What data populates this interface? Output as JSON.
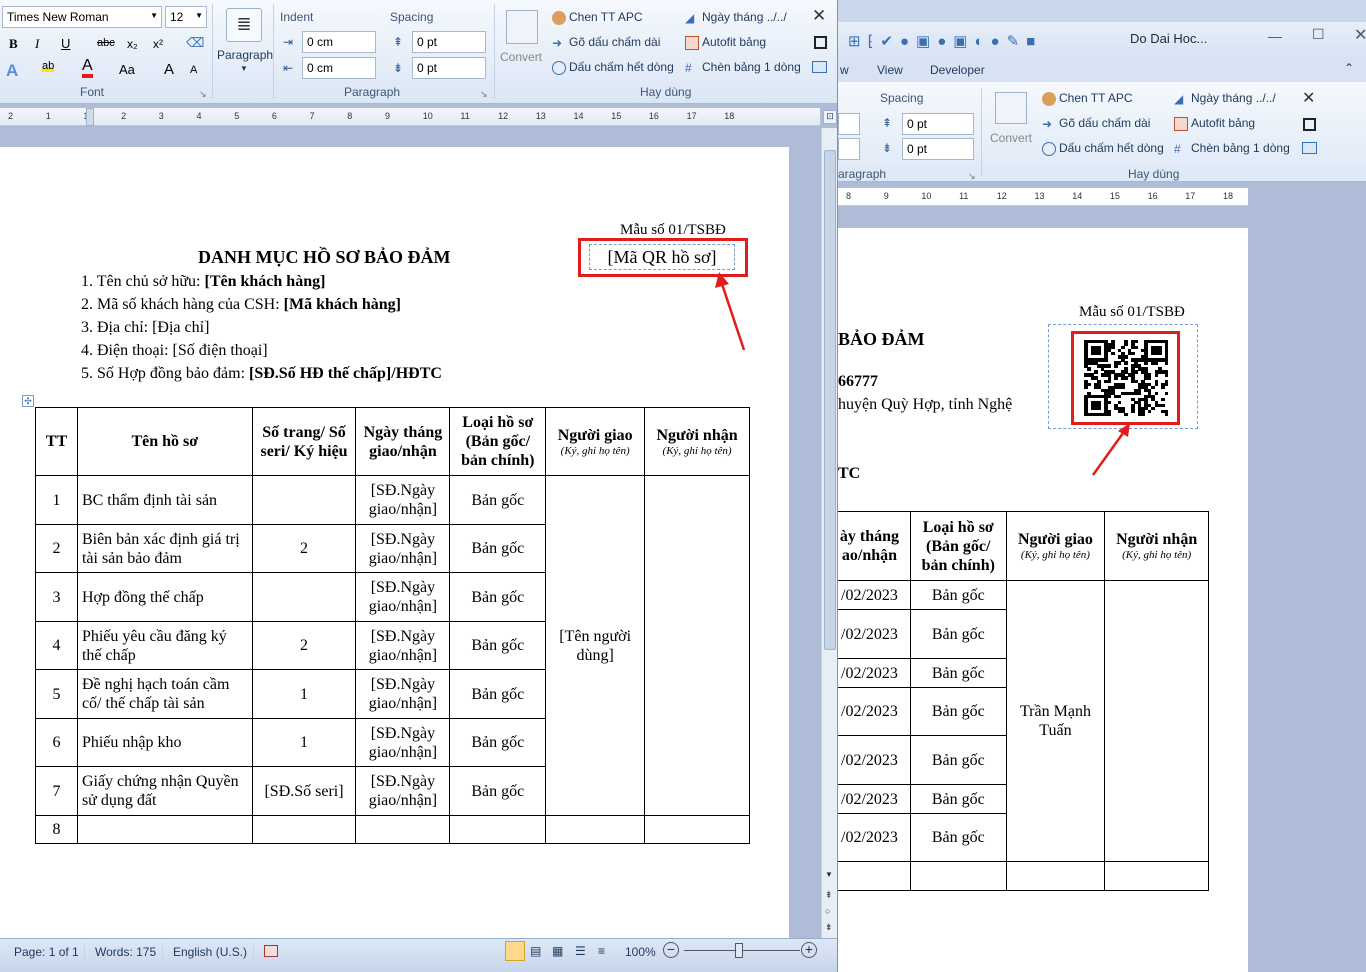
{
  "window1": {
    "ribbon": {
      "font_name": "Times New Roman",
      "font_size": "12",
      "font_group_label": "Font",
      "paragraph_button": "Paragraph",
      "paragraph_group_label": "Paragraph",
      "indent_label": "Indent",
      "spacing_label": "Spacing",
      "indent_left": "0 cm",
      "indent_right": "0 cm",
      "spacing_before": "0 pt",
      "spacing_after": "0 pt",
      "convert": "Convert",
      "chen_tt": "Chen TT APC",
      "go_dau": "Gõ dấu chấm dài",
      "dau_cham": "Dấu chấm hết dòng",
      "ngay_thang": "Ngày tháng ../../",
      "autofit": "Autofit bảng",
      "chen_bang": "Chèn bảng 1 dòng",
      "hay_dung": "Hay dùng",
      "format_buttons": {
        "bold": "B",
        "italic": "I",
        "underline": "U",
        "strike": "abc",
        "sub": "x₂",
        "sup": "x²",
        "case": "Aa",
        "grow": "A",
        "shrink": "A"
      }
    },
    "ruler": [
      "2",
      "1",
      "1",
      "2",
      "3",
      "4",
      "5",
      "6",
      "7",
      "8",
      "9",
      "10",
      "11",
      "12",
      "13",
      "14",
      "15",
      "16",
      "17",
      "18"
    ],
    "doc": {
      "form_no": "Mẫu số 01/TSBĐ",
      "qr_placeholder": "[Mã QR hồ sơ]",
      "title": "DANH MỤC HỒ SƠ BẢO ĐẢM",
      "lines": [
        {
          "label": "1. Tên chủ sở hữu: ",
          "value": "[Tên khách hàng]"
        },
        {
          "label": "2. Mã số khách hàng của CSH:  ",
          "value": "[Mã khách hàng]"
        },
        {
          "label": "3. Địa chỉ: [Địa chỉ]",
          "value": ""
        },
        {
          "label": "4. Điện thoại: [Số điện thoại]",
          "value": ""
        },
        {
          "label": "5. Số Hợp đồng bảo đảm: ",
          "value": "[SĐ.Số HĐ thế chấp]/HĐTC"
        }
      ],
      "headers": {
        "tt": "TT",
        "ten": "Tên hồ sơ",
        "so_trang": "Số trang/ Số seri/ Ký hiệu",
        "ngay": "Ngày tháng giao/nhận",
        "loai": "Loại hồ sơ (Bản gốc/ bản chính)",
        "nguoi_giao": "Người giao",
        "nguoi_nhan": "Người nhận",
        "ky": "(Ký, ghi họ tên)"
      },
      "rows": [
        {
          "tt": "1",
          "ten": "BC thẩm định tài sản",
          "so": "",
          "ngay": "[SĐ.Ngày giao/nhận]",
          "loai": "Bản gốc"
        },
        {
          "tt": "2",
          "ten": "Biên bản xác định giá trị tài sản bảo đảm",
          "so": "2",
          "ngay": "[SĐ.Ngày giao/nhận]",
          "loai": "Bản gốc"
        },
        {
          "tt": "3",
          "ten": "Hợp đồng thế chấp",
          "so": "",
          "ngay": "[SĐ.Ngày giao/nhận]",
          "loai": "Bản gốc"
        },
        {
          "tt": "4",
          "ten": "Phiếu yêu cầu đăng ký thế chấp",
          "so": "2",
          "ngay": "[SĐ.Ngày giao/nhận]",
          "loai": "Bản gốc"
        },
        {
          "tt": "5",
          "ten": "Đề nghị hạch toán cầm cố/ thế chấp tài sản",
          "so": "1",
          "ngay": "[SĐ.Ngày giao/nhận]",
          "loai": "Bản gốc"
        },
        {
          "tt": "6",
          "ten": "Phiếu nhập kho",
          "so": "1",
          "ngay": "[SĐ.Ngày giao/nhận]",
          "loai": "Bản gốc"
        },
        {
          "tt": "7",
          "ten": "Giấy chứng nhận Quyền sử dụng đất",
          "so": "[SĐ.Số seri]",
          "ngay": "[SĐ.Ngày giao/nhận]",
          "loai": "Bản gốc"
        },
        {
          "tt": "8",
          "ten": "",
          "so": "",
          "ngay": "",
          "loai": ""
        }
      ],
      "nguoi_giao_value": "[Tên người dùng]"
    },
    "status": {
      "page": "Page: 1 of 1",
      "words": "Words: 175",
      "lang": "English (U.S.)",
      "zoom": "100%"
    }
  },
  "window2": {
    "title": "Do Dai Hoc...",
    "tabs": {
      "view": "View",
      "developer": "Developer",
      "w": "w"
    },
    "spacing_label": "Spacing",
    "spacing_before": "0 pt",
    "spacing_after": "0 pt",
    "convert": "Convert",
    "chen_tt": "Chen TT APC",
    "go_dau": "Gõ dấu chấm dài",
    "dau_cham": "Dấu chấm hết dòng",
    "ngay_thang": "Ngày tháng ../../",
    "autofit": "Autofit bảng",
    "chen_bang": "Chèn bảng 1 dòng",
    "hay_dung": "Hay dùng",
    "paragraph_label": "aragraph",
    "ruler": [
      "8",
      "9",
      "10",
      "11",
      "12",
      "13",
      "14",
      "15",
      "16",
      "17",
      "18"
    ],
    "doc": {
      "form_no": "Mẫu số 01/TSBĐ",
      "title_frag": "BẢO ĐẢM",
      "code_frag": "66777",
      "addr_frag": "huyện Quỳ Hợp, tỉnh Nghệ",
      "htc_frag": "TC",
      "headers": {
        "ngay": "ày tháng ao/nhận",
        "loai": "Loại hồ sơ (Bản gốc/ bản chính)",
        "nguoi_giao": "Người giao",
        "nguoi_nhan": "Người nhận",
        "ky": "(Ký, ghi họ tên)"
      },
      "dates": [
        "/02/2023",
        "/02/2023",
        "/02/2023",
        "/02/2023",
        "/02/2023",
        "/02/2023",
        "/02/2023"
      ],
      "loai": [
        "Bản gốc",
        "Bản gốc",
        "Bản gốc",
        "Bản gốc",
        "Bản gốc",
        "Bản gốc",
        "Bản gốc"
      ],
      "nguoi_giao_value": "Trần Mạnh Tuấn"
    }
  }
}
